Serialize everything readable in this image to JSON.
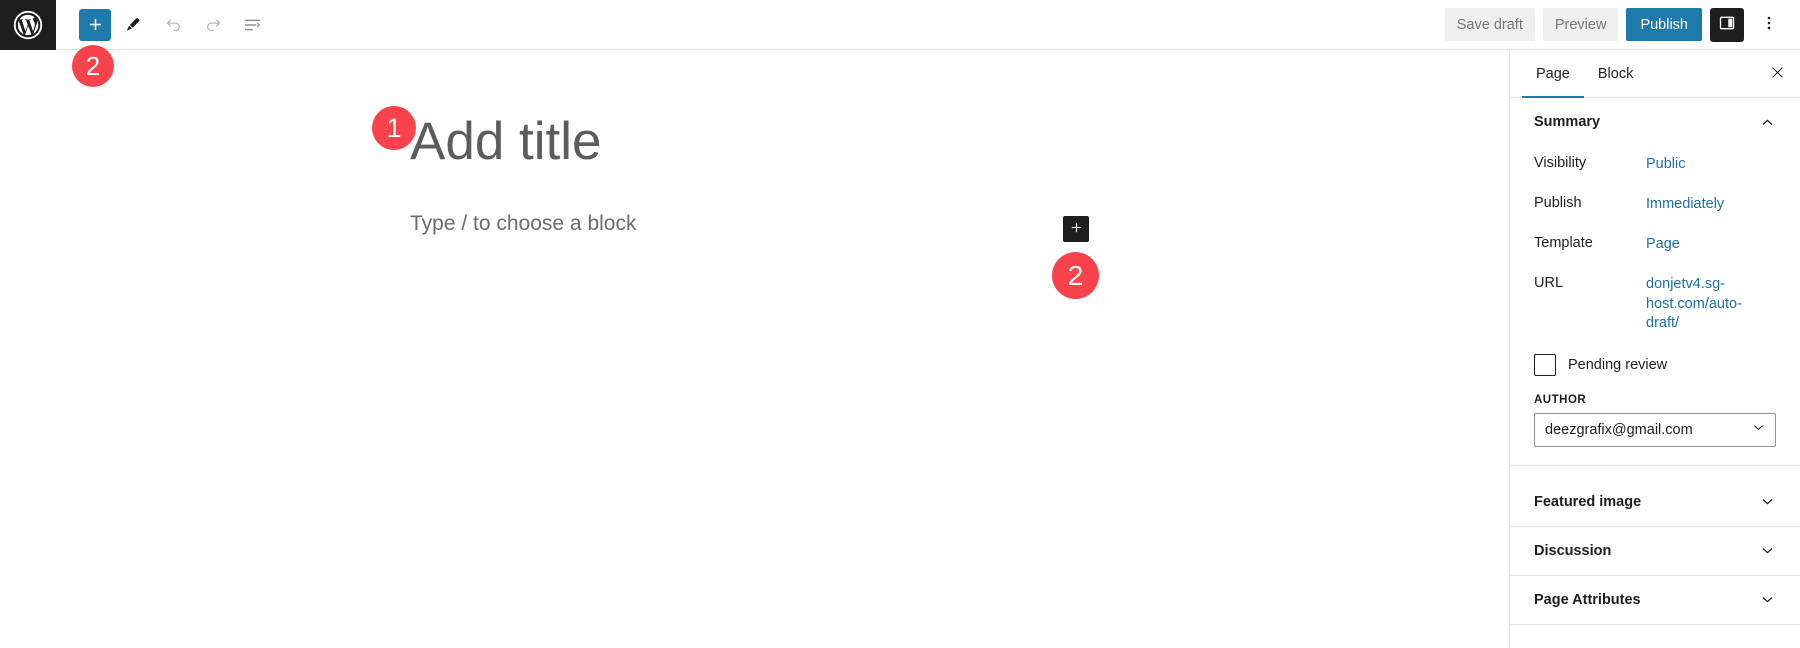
{
  "header": {
    "logo_icon": "wordpress-logo-icon",
    "tools": [
      {
        "name": "add-block-button",
        "icon": "plus-icon",
        "label": "Add block",
        "primary": true
      },
      {
        "name": "tools-button",
        "icon": "pencil-icon",
        "label": "Tools"
      },
      {
        "name": "undo-button",
        "icon": "undo-arrow-icon",
        "label": "Undo"
      },
      {
        "name": "redo-button",
        "icon": "redo-arrow-icon",
        "label": "Redo"
      },
      {
        "name": "details-button",
        "icon": "document-overview-icon",
        "label": "Document Overview"
      }
    ],
    "save_draft_label": "Save draft",
    "preview_label": "Preview",
    "publish_label": "Publish",
    "settings_toggle_icon": "sidebar-panel-icon",
    "options_icon": "vertical-ellipsis-icon"
  },
  "editor": {
    "title_placeholder": "Add title",
    "block_placeholder": "Type / to choose a block",
    "inserter_icon": "plus-icon"
  },
  "annotations": [
    {
      "id": "badge-1",
      "number": "1"
    },
    {
      "id": "badge-2a",
      "number": "2"
    },
    {
      "id": "badge-2b",
      "number": "2"
    }
  ],
  "sidebar": {
    "tabs": [
      {
        "label": "Page",
        "active": true
      },
      {
        "label": "Block",
        "active": false
      }
    ],
    "close_icon": "close-x-icon",
    "summary": {
      "title": "Summary",
      "expanded": true,
      "chevron_icon": "chevron-up-icon",
      "rows": [
        {
          "label": "Visibility",
          "value": "Public"
        },
        {
          "label": "Publish",
          "value": "Immediately"
        },
        {
          "label": "Template",
          "value": "Page"
        },
        {
          "label": "URL",
          "value": "donjetv4.sg-host.com/auto-draft/"
        }
      ],
      "pending_review_label": "Pending review",
      "pending_review_checked": false,
      "author_field_label": "AUTHOR",
      "author_value": "deezgrafix@gmail.com",
      "author_chevron_icon": "chevron-down-icon"
    },
    "panels": [
      {
        "title": "Featured image",
        "chevron_icon": "chevron-down-icon"
      },
      {
        "title": "Discussion",
        "chevron_icon": "chevron-down-icon"
      },
      {
        "title": "Page Attributes",
        "chevron_icon": "chevron-down-icon"
      }
    ]
  },
  "colors": {
    "accent_blue": "#1e7aab",
    "link_blue": "#1d6ea8",
    "badge_red": "#f8434c",
    "dark": "#1e1e1e",
    "border": "#e0e0e0"
  }
}
